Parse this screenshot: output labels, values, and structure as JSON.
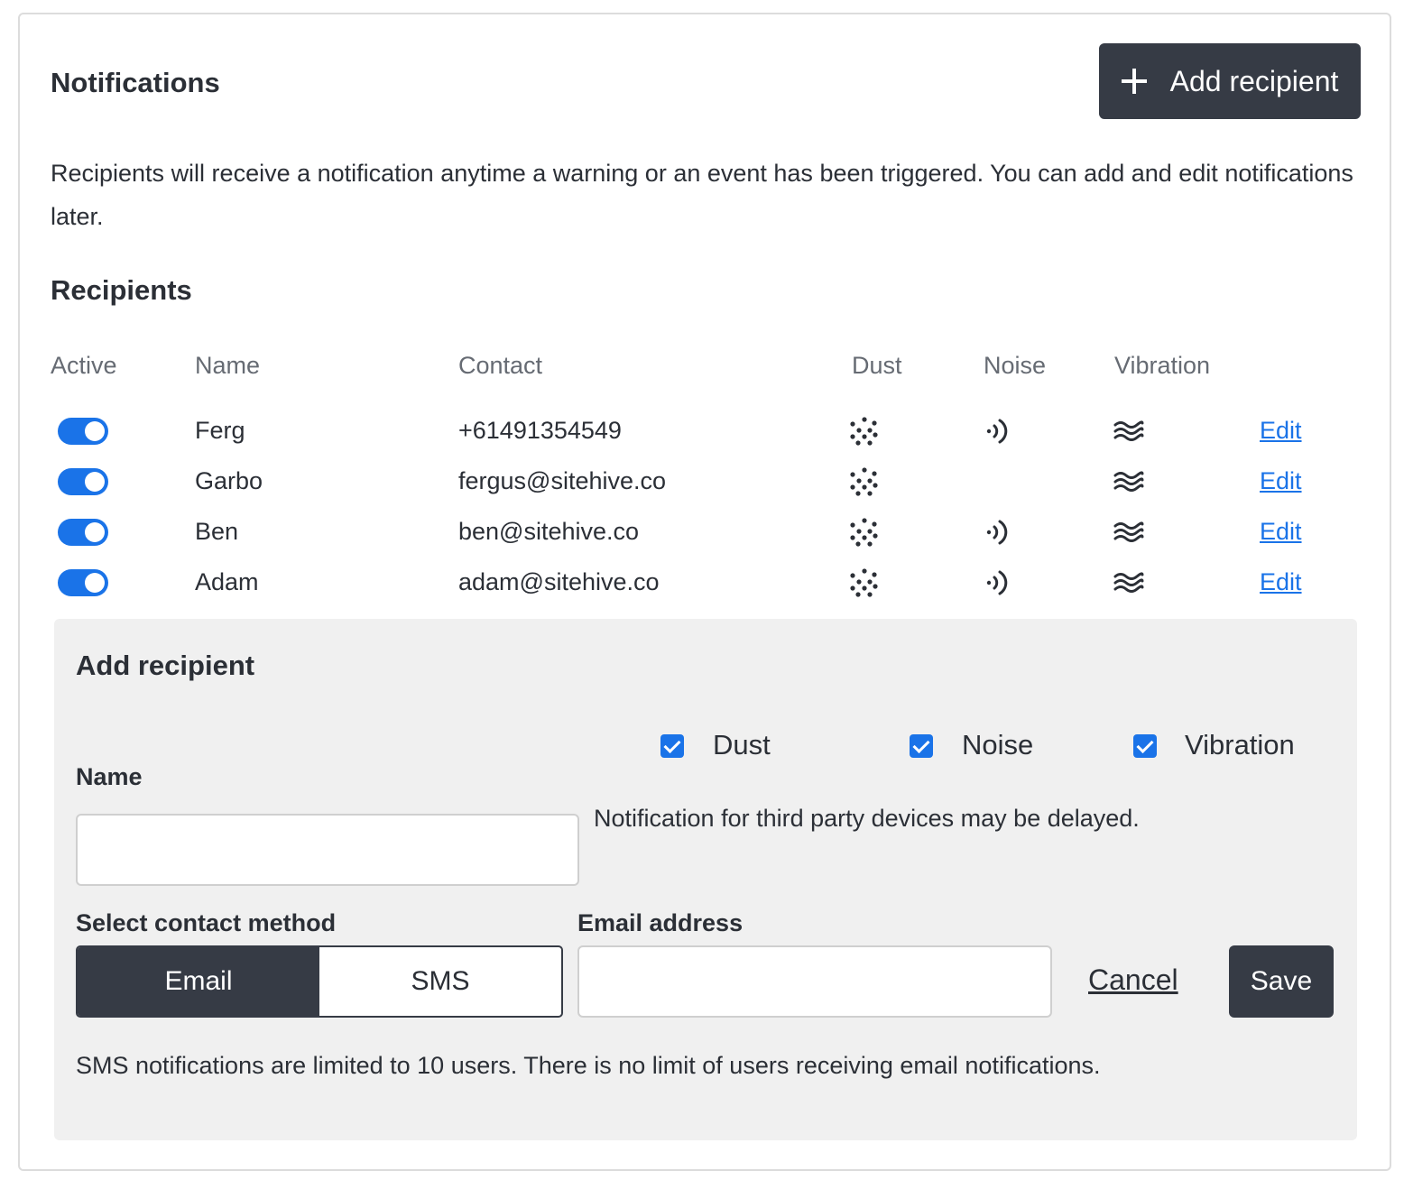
{
  "header": {
    "title": "Notifications",
    "add_button_label": "Add recipient"
  },
  "intro_text": "Recipients will receive a notification anytime a warning or an event has been triggered. You can add and edit notifications later.",
  "recipients": {
    "title": "Recipients",
    "columns": [
      "Active",
      "Name",
      "Contact",
      "Dust",
      "Noise",
      "Vibration"
    ],
    "rows": [
      {
        "active": true,
        "name": "Ferg",
        "contact": "+61491354549",
        "dust": true,
        "noise": true,
        "vibration": true,
        "edit_label": "Edit"
      },
      {
        "active": true,
        "name": "Garbo",
        "contact": "fergus@sitehive.co",
        "dust": true,
        "noise": false,
        "vibration": true,
        "edit_label": "Edit"
      },
      {
        "active": true,
        "name": "Ben",
        "contact": "ben@sitehive.co",
        "dust": true,
        "noise": true,
        "vibration": true,
        "edit_label": "Edit"
      },
      {
        "active": true,
        "name": "Adam",
        "contact": "adam@sitehive.co",
        "dust": true,
        "noise": true,
        "vibration": true,
        "edit_label": "Edit"
      }
    ],
    "icons": {
      "dust": "dust-icon",
      "noise": "noise-icon",
      "vibration": "vibration-icon"
    }
  },
  "add_form": {
    "title": "Add recipient",
    "checkboxes": [
      {
        "label": "Dust",
        "checked": true
      },
      {
        "label": "Noise",
        "checked": true
      },
      {
        "label": "Vibration",
        "checked": true
      }
    ],
    "name_label": "Name",
    "name_value": "",
    "third_party_note": "Notification for third party devices may be delayed.",
    "contact_method_label": "Select contact method",
    "contact_methods": [
      "Email",
      "SMS"
    ],
    "selected_method": "Email",
    "email_label": "Email address",
    "email_value": "",
    "cancel_label": "Cancel",
    "save_label": "Save",
    "sms_note": "SMS notifications are limited to 10 users. There is no limit of users receiving email notifications."
  },
  "colors": {
    "accent": "#1a73e8",
    "dark": "#363b45",
    "panel_bg": "#f0f0f0"
  }
}
